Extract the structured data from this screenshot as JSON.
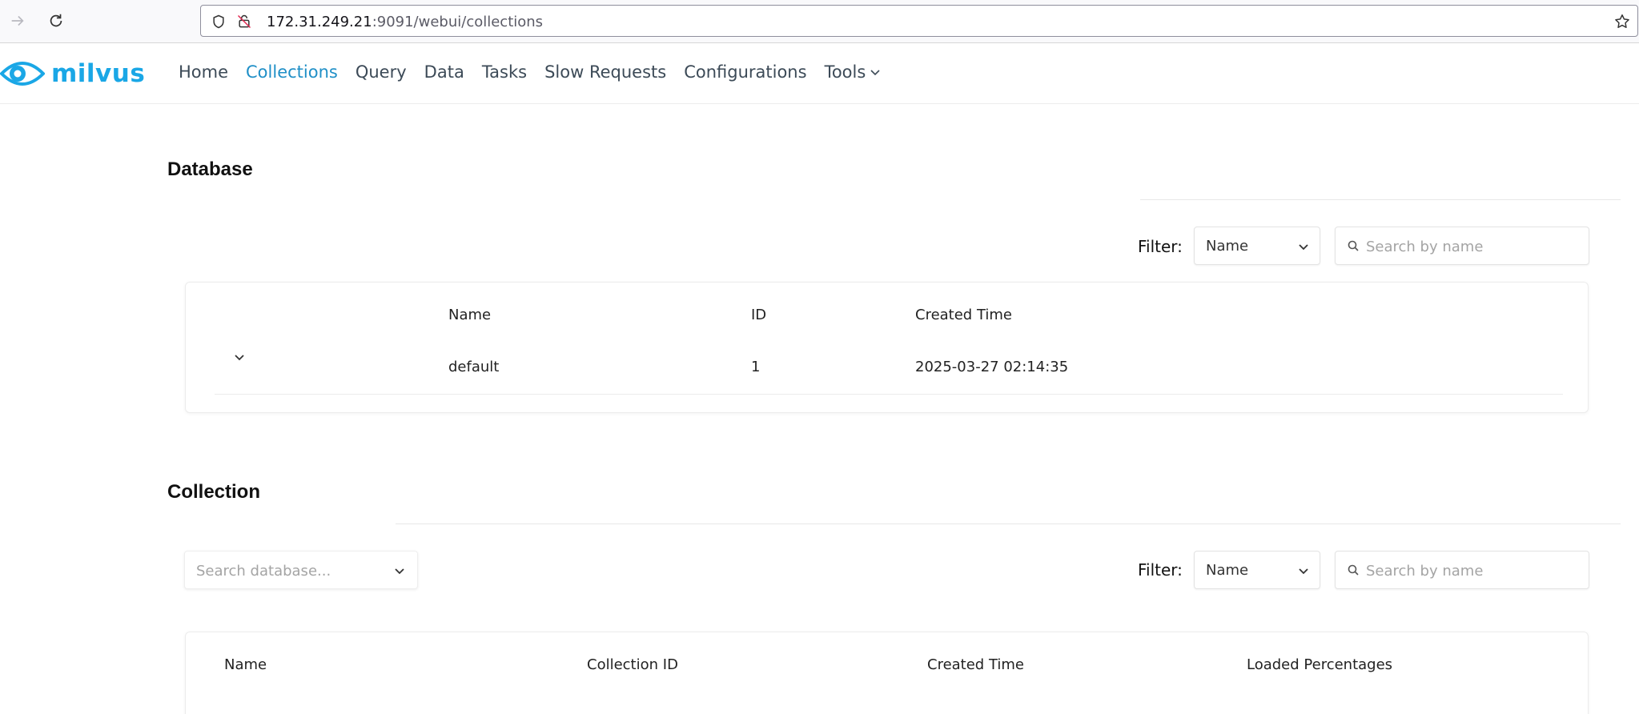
{
  "browser": {
    "url_host": "172.31.249.21",
    "url_rest": ":9091/webui/collections"
  },
  "app": {
    "logo_text": "milvus",
    "nav": [
      {
        "label": "Home",
        "active": false
      },
      {
        "label": "Collections",
        "active": true
      },
      {
        "label": "Query",
        "active": false
      },
      {
        "label": "Data",
        "active": false
      },
      {
        "label": "Tasks",
        "active": false
      },
      {
        "label": "Slow Requests",
        "active": false
      },
      {
        "label": "Configurations",
        "active": false
      },
      {
        "label": "Tools",
        "active": false
      }
    ],
    "accent_color": "#1aa7e6"
  },
  "database_section": {
    "title": "Database",
    "filter_label": "Filter:",
    "filter_value": "Name",
    "search_placeholder": "Search by name",
    "columns": [
      "Name",
      "ID",
      "Created Time"
    ],
    "rows": [
      {
        "name": "default",
        "id": "1",
        "created_time": "2025-03-27 02:14:35"
      }
    ]
  },
  "collection_section": {
    "title": "Collection",
    "db_search_placeholder": "Search database...",
    "filter_label": "Filter:",
    "filter_value": "Name",
    "search_placeholder": "Search by name",
    "columns": [
      "Name",
      "Collection ID",
      "Created Time",
      "Loaded Percentages"
    ]
  }
}
